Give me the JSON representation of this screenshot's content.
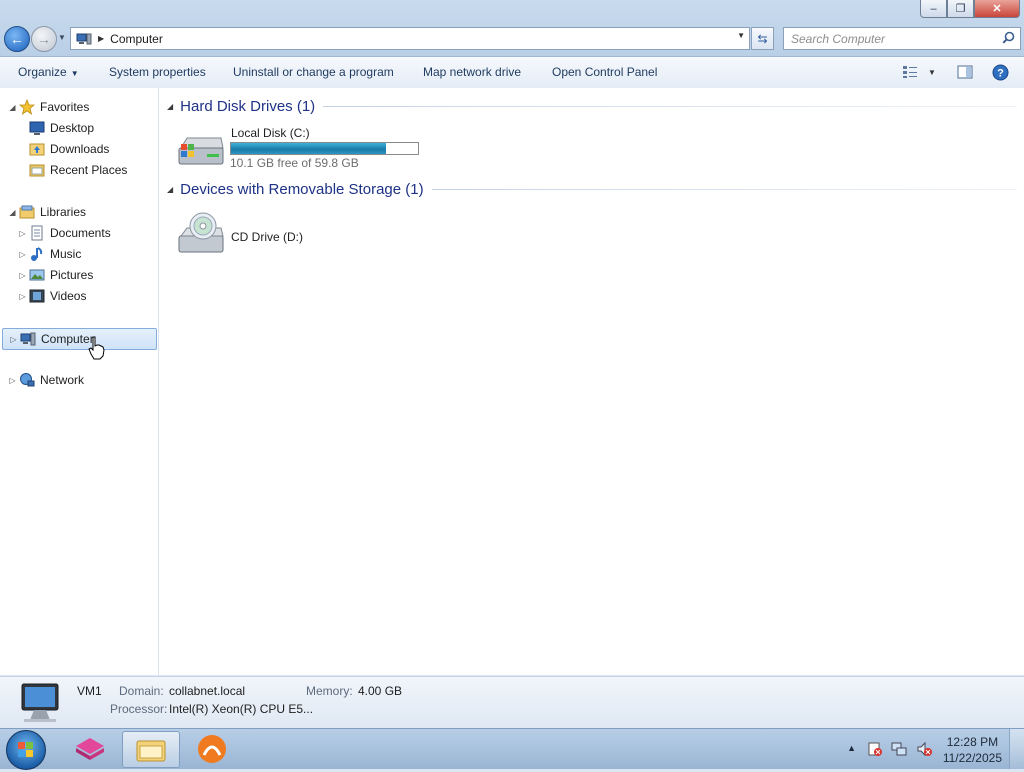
{
  "window": {
    "minimize_symbol": "–",
    "maximize_symbol": "❐",
    "close_symbol": "✕"
  },
  "address": {
    "location": "Computer",
    "search_placeholder": "Search Computer"
  },
  "toolbar": {
    "organize": "Organize",
    "system_properties": "System properties",
    "uninstall": "Uninstall or change a program",
    "map_drive": "Map network drive",
    "control_panel": "Open Control Panel"
  },
  "nav": {
    "favorites": "Favorites",
    "desktop": "Desktop",
    "downloads": "Downloads",
    "recent_places": "Recent Places",
    "libraries": "Libraries",
    "documents": "Documents",
    "music": "Music",
    "pictures": "Pictures",
    "videos": "Videos",
    "computer": "Computer",
    "network": "Network"
  },
  "groups": {
    "hdd_header": "Hard Disk Drives (1)",
    "removable_header": "Devices with Removable Storage (1)"
  },
  "drives": {
    "c_name": "Local Disk (C:)",
    "c_free": "10.1 GB free of 59.8 GB",
    "c_used_fraction": 0.83,
    "d_name": "CD Drive (D:)"
  },
  "details": {
    "name": "VM1",
    "domain_label": "Domain:",
    "domain_value": "collabnet.local",
    "memory_label": "Memory:",
    "memory_value": "4.00 GB",
    "processor_label": "Processor:",
    "processor_value": "Intel(R) Xeon(R) CPU E5..."
  },
  "taskbar": {
    "time": "12:28 PM",
    "date": "11/22/2025"
  },
  "colors": {
    "accent": "#1e3287",
    "capacity_fill": "#2b97c6"
  }
}
